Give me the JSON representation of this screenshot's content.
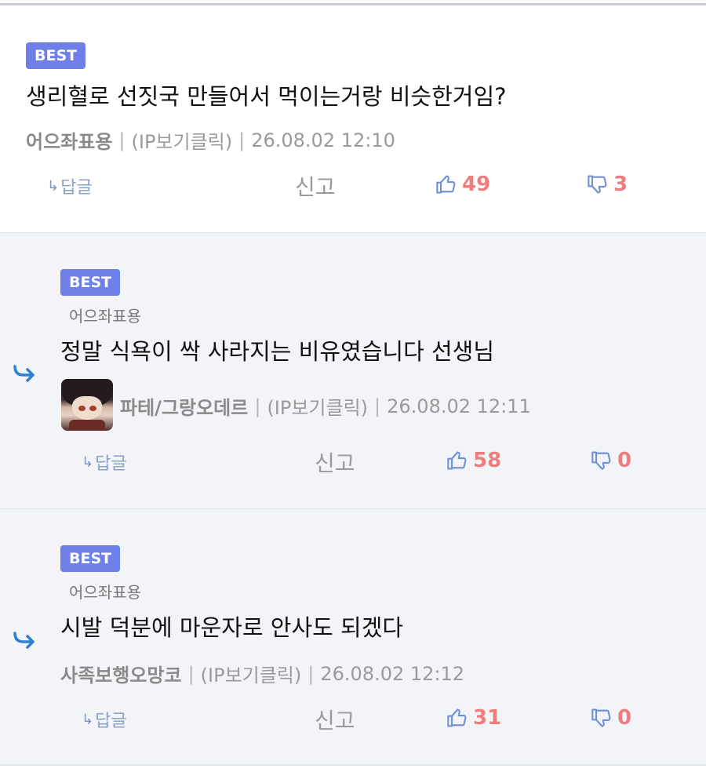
{
  "comments": [
    {
      "badge": "BEST",
      "parent_ref": "",
      "body": "생리혈로 선짓국 만들어서 먹이는거랑 비슷한거임?",
      "author": "어으좌표용",
      "ip": "(IP보기클릭)",
      "timestamp": "26.08.02 12:10",
      "reply_label": "답글",
      "report_label": "신고",
      "likes": "49",
      "dislikes": "3"
    },
    {
      "badge": "BEST",
      "parent_ref": "어으좌표용",
      "body": "정말 식욕이 싹 사라지는 비유였습니다 선생님",
      "author": "파테/그랑오데르",
      "ip": "(IP보기클릭)",
      "timestamp": "26.08.02 12:11",
      "reply_label": "답글",
      "report_label": "신고",
      "likes": "58",
      "dislikes": "0"
    },
    {
      "badge": "BEST",
      "parent_ref": "어으좌표용",
      "body": "시발 덕분에 마운자로 안사도 되겠다",
      "author": "사족보행오망코",
      "ip": "(IP보기클릭)",
      "timestamp": "26.08.02 12:12",
      "reply_label": "답글",
      "report_label": "신고",
      "likes": "31",
      "dislikes": "0"
    }
  ],
  "colors": {
    "badge": "#6e7fe8",
    "count": "#ef7d7d",
    "thumb_icon": "#6f8fd6",
    "reply_arrow": "#2f7fd0",
    "nested_bg": "#f2f4f7"
  }
}
